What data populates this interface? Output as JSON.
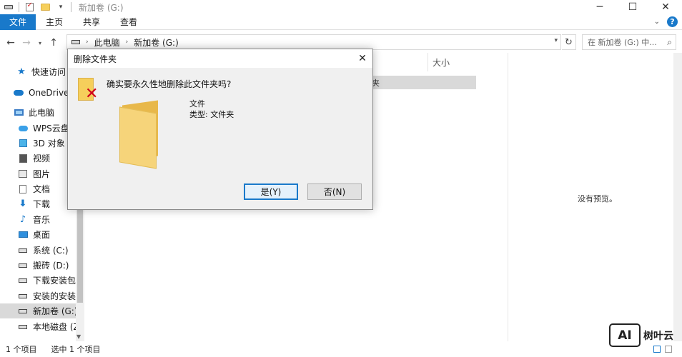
{
  "window": {
    "title": "新加卷 (G:)",
    "minimize_glyph": "─",
    "maximize_glyph": "☐",
    "close_glyph": "✕"
  },
  "ribbon": {
    "tabs": [
      "文件",
      "主页",
      "共享",
      "查看"
    ],
    "active_tab": "文件",
    "help_glyph": "?"
  },
  "address": {
    "crumbs": [
      "此电脑",
      "新加卷 (G:)"
    ],
    "search_placeholder": "在 新加卷 (G:) 中..."
  },
  "sidebar": {
    "items": [
      {
        "label": "快速访问",
        "icon": "star-icon"
      },
      {
        "label": "OneDrive -",
        "icon": "cloud-icon"
      },
      {
        "label": "此电脑",
        "icon": "computer-icon"
      },
      {
        "label": "WPS云盘",
        "icon": "wps-cloud-icon"
      },
      {
        "label": "3D 对象",
        "icon": "cube-icon"
      },
      {
        "label": "视频",
        "icon": "video-icon"
      },
      {
        "label": "图片",
        "icon": "picture-icon"
      },
      {
        "label": "文档",
        "icon": "document-icon"
      },
      {
        "label": "下载",
        "icon": "download-icon"
      },
      {
        "label": "音乐",
        "icon": "music-icon"
      },
      {
        "label": "桌面",
        "icon": "desktop-icon"
      },
      {
        "label": "系统 (C:)",
        "icon": "drive-icon"
      },
      {
        "label": "搬砖 (D:)",
        "icon": "drive-icon"
      },
      {
        "label": "下载安装包",
        "icon": "drive-icon"
      },
      {
        "label": "安装的安装包",
        "icon": "drive-icon"
      },
      {
        "label": "新加卷 (G:)",
        "icon": "drive-icon",
        "selected": true
      },
      {
        "label": "本地磁盘 (Z:",
        "icon": "drive-icon"
      }
    ]
  },
  "content": {
    "column_size": "大小",
    "selected_row_tail": "夹"
  },
  "preview": {
    "empty_text": "没有预览。"
  },
  "status": {
    "item_count": "1 个项目",
    "selected_count": "选中 1 个项目"
  },
  "dialog": {
    "title": "删除文件夹",
    "question": "确实要永久性地删除此文件夹吗?",
    "item_name": "文件",
    "item_type": "类型: 文件夹",
    "yes_label": "是(Y)",
    "no_label": "否(N)",
    "close_glyph": "✕"
  },
  "watermark": {
    "badge": "AI",
    "text": "树叶云"
  },
  "colors": {
    "accent": "#1979ca",
    "folder": "#f6cf5b",
    "delete_x": "#d0021b"
  }
}
